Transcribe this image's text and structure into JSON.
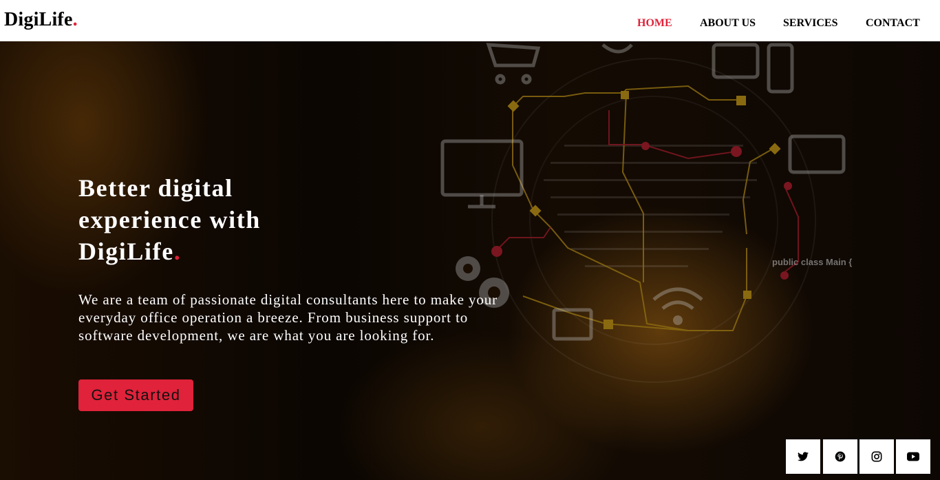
{
  "brand": {
    "name": "DigiLife",
    "dot": ".",
    "accent_color": "#e0223a"
  },
  "nav": {
    "items": [
      {
        "label": "HOME",
        "active": true
      },
      {
        "label": "ABOUT US",
        "active": false
      },
      {
        "label": "SERVICES",
        "active": false
      },
      {
        "label": "CONTACT",
        "active": false
      }
    ]
  },
  "hero": {
    "title_lines": [
      "Better digital",
      "experience with",
      "DigiLife"
    ],
    "title_dot": ".",
    "description": "We are a team of passionate digital consultants here to make your everyday office operation a breeze. From business support to software development, we are what you are looking for.",
    "cta_label": "Get Started",
    "code_text": "public class Main {"
  },
  "social": [
    {
      "name": "twitter-icon"
    },
    {
      "name": "pinterest-icon"
    },
    {
      "name": "instagram-icon"
    },
    {
      "name": "youtube-icon"
    }
  ]
}
